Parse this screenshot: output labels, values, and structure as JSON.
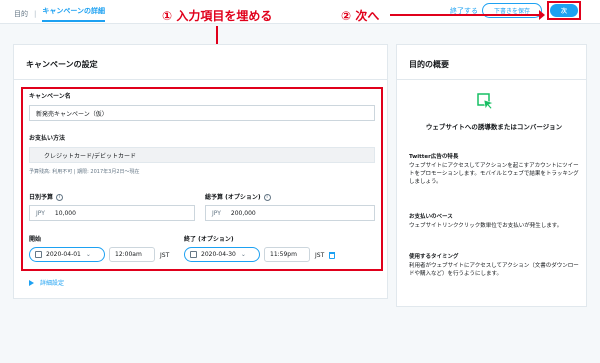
{
  "breadcrumb": {
    "step1": "目的",
    "step2": "キャンペーンの詳細"
  },
  "header": {
    "finish_link": "終了する",
    "save_draft": "下書きを保存",
    "next": "次"
  },
  "annotations": {
    "fill_fields": "① 入力項目を埋める",
    "next_step": "② 次へ"
  },
  "settings": {
    "title": "キャンペーンの設定",
    "campaign_name": {
      "label": "キャンペーン名",
      "value": "新発売キャンペーン（仮）"
    },
    "payment": {
      "label": "お支払い方法",
      "value": "クレジットカード/デビットカード",
      "note": "予算残高: 利用不可 | 期限: 2017年3月2日〜現在"
    },
    "daily_budget": {
      "label": "日別予算",
      "info": "i",
      "currency": "JPY",
      "value": "10,000"
    },
    "total_budget": {
      "label": "総予算 (オプション)",
      "info": "i",
      "currency": "JPY",
      "value": "200,000"
    },
    "start": {
      "label": "開始",
      "date": "2020-04-01",
      "time": "12:00am",
      "tz": "JST"
    },
    "end": {
      "label": "終了 (オプション)",
      "date": "2020-04-30",
      "time": "11:59pm",
      "tz": "JST"
    },
    "advanced": "詳細設定"
  },
  "overview": {
    "title": "目的の概要",
    "objective": "ウェブサイトへの誘導数またはコンバージョン",
    "features": {
      "heading": "Twitter広告の特長",
      "body": "ウェブサイトにアクセスしてアクションを起こすアカウントにツイートをプロモーションします。モバイルとウェブで結果をトラッキングしましょう。"
    },
    "billing": {
      "heading": "お支払いのベース",
      "body": "ウェブサイトリンククリック数単位でお支払いが発生します。"
    },
    "timing": {
      "heading": "使用するタイミング",
      "body": "利用者がウェブサイトにアクセスしてアクション（文書のダウンロードや購入など）を行うようにします。"
    }
  },
  "colors": {
    "accent": "#1da1f2",
    "annotation": "#e0001b",
    "icon_green": "#17bf63"
  },
  "icons": {
    "calendar": "calendar-icon",
    "info": "info-icon",
    "trash": "trash-icon",
    "cursor": "cursor-click-icon"
  }
}
